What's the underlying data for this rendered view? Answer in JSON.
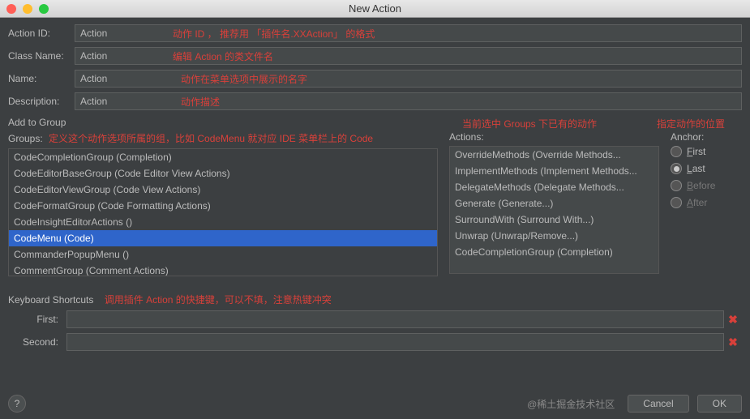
{
  "window": {
    "title": "New Action"
  },
  "form": {
    "action_id": {
      "label": "Action ID:",
      "value": "Action",
      "note": "动作 ID ， 推荐用 「插件名.XXAction」 的格式"
    },
    "class_name": {
      "label": "Class Name:",
      "value": "Action",
      "note": "编辑 Action 的类文件名"
    },
    "name": {
      "label": "Name:",
      "value": "Action",
      "note": "动作在菜单选项中展示的名字"
    },
    "description": {
      "label": "Description:",
      "value": "Action",
      "note": "动作描述"
    }
  },
  "add_to_group": {
    "title": "Add to Group",
    "groups_label": "Groups:",
    "groups_note": "定义这个动作选项所属的组，比如 CodeMenu 就对应 IDE 菜单栏上的 Code",
    "actions_label": "Actions:",
    "actions_note": "当前选中 Groups 下已有的动作",
    "anchor_label": "Anchor:",
    "anchor_note": "指定动作的位置",
    "groups": [
      "CodeCompletionGroup (Completion)",
      "CodeEditorBaseGroup (Code Editor View Actions)",
      "CodeEditorViewGroup (Code View Actions)",
      "CodeFormatGroup (Code Formatting Actions)",
      "CodeInsightEditorActions ()",
      "CodeMenu (Code)",
      "CommanderPopupMenu ()",
      "CommentGroup (Comment Actions)"
    ],
    "groups_selected": 5,
    "actions": [
      "OverrideMethods (Override Methods...",
      "ImplementMethods (Implement Methods...",
      "DelegateMethods (Delegate Methods...",
      "Generate (Generate...)",
      "SurroundWith (Surround With...)",
      "Unwrap (Unwrap/Remove...)",
      "CodeCompletionGroup (Completion)"
    ],
    "anchor": {
      "options": [
        {
          "key": "first",
          "label": "First",
          "u": "F",
          "rest": "irst",
          "enabled": true,
          "checked": false
        },
        {
          "key": "last",
          "label": "Last",
          "u": "L",
          "rest": "ast",
          "enabled": true,
          "checked": true
        },
        {
          "key": "before",
          "label": "Before",
          "u": "B",
          "rest": "efore",
          "enabled": false,
          "checked": false
        },
        {
          "key": "after",
          "label": "After",
          "u": "A",
          "rest": "fter",
          "enabled": false,
          "checked": false
        }
      ]
    }
  },
  "shortcuts": {
    "title": "Keyboard Shortcuts",
    "note": "调用插件 Action 的快捷键，可以不填，注意热键冲突",
    "first_label": "First:",
    "second_label": "Second:"
  },
  "buttons": {
    "cancel": "Cancel",
    "ok": "OK"
  },
  "watermark": "@稀土掘金技术社区"
}
